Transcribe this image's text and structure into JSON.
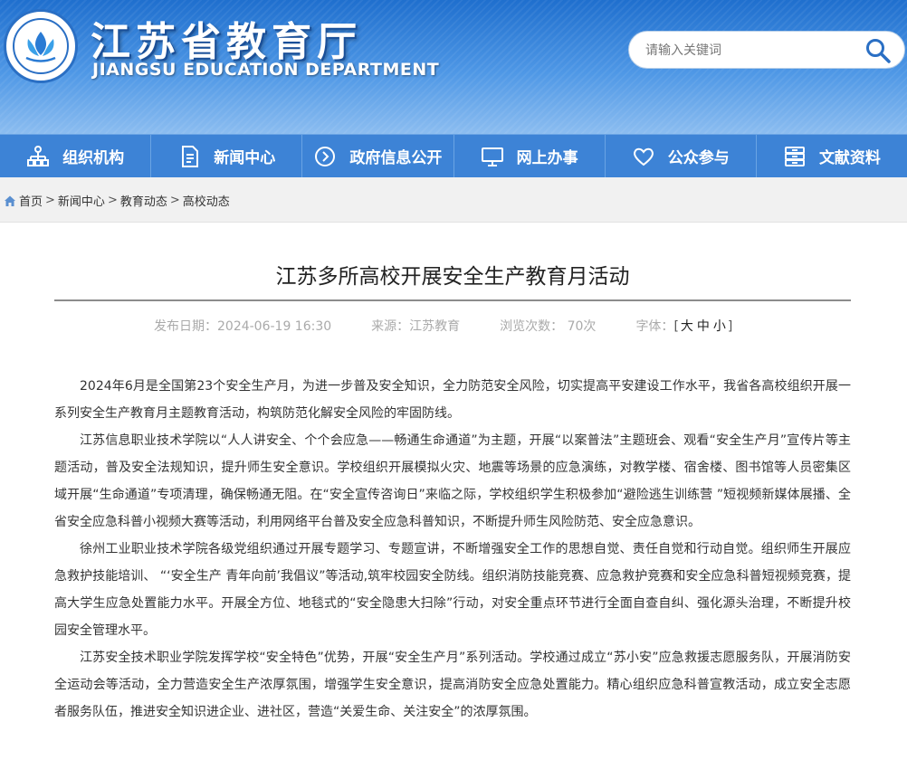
{
  "header": {
    "title_cn": "江苏省教育厅",
    "title_en": "JIANGSU EDUCATION DEPARTMENT",
    "search_placeholder": "请输入关键词"
  },
  "nav": {
    "items": [
      {
        "label": "组织机构",
        "icon": "org-chart-icon"
      },
      {
        "label": "新闻中心",
        "icon": "document-icon"
      },
      {
        "label": "政府信息公开",
        "icon": "disclosure-icon"
      },
      {
        "label": "网上办事",
        "icon": "monitor-icon"
      },
      {
        "label": "公众参与",
        "icon": "heart-icon"
      },
      {
        "label": "文献资料",
        "icon": "archive-icon"
      }
    ]
  },
  "breadcrumb": {
    "items": [
      "首页",
      "新闻中心",
      "教育动态",
      "高校动态"
    ],
    "separator": ">"
  },
  "article": {
    "title": "江苏多所高校开展安全生产教育月活动",
    "meta": {
      "date": "发布日期：2024-06-19 16:30",
      "source": "来源：江苏教育",
      "views": "浏览次数： 70次",
      "font_label": "字体：",
      "font_open": "[",
      "font_large": "大",
      "font_medium": "中",
      "font_small": "小",
      "font_close": "]"
    },
    "paragraphs": [
      "2024年6月是全国第23个安全生产月，为进一步普及安全知识，全力防范安全风险，切实提高平安建设工作水平，我省各高校组织开展一系列安全生产教育月主题教育活动，构筑防范化解安全风险的牢固防线。",
      "江苏信息职业技术学院以“人人讲安全、个个会应急——畅通生命通道”为主题，开展“以案普法”主题班会、观看“安全生产月”宣传片等主题活动，普及安全法规知识，提升师生安全意识。学校组织开展模拟火灾、地震等场景的应急演练，对教学楼、宿舍楼、图书馆等人员密集区域开展“生命通道”专项清理，确保畅通无阻。在“安全宣传咨询日”来临之际，学校组织学生积极参加“避险逃生训练营 ”短视频新媒体展播、全省安全应急科普小视频大赛等活动，利用网络平台普及安全应急科普知识，不断提升师生风险防范、安全应急意识。",
      "徐州工业职业技术学院各级党组织通过开展专题学习、专题宣讲，不断增强安全工作的思想自觉、责任自觉和行动自觉。组织师生开展应急救护技能培训、 “‘安全生产 青年向前’我倡议”等活动,筑牢校园安全防线。组织消防技能竞赛、应急救护竞赛和安全应急科普短视频竞赛，提高大学生应急处置能力水平。开展全方位、地毯式的“安全隐患大扫除”行动，对安全重点环节进行全面自查自纠、强化源头治理，不断提升校园安全管理水平。",
      "江苏安全技术职业学院发挥学校“安全特色”优势，开展“安全生产月”系列活动。学校通过成立“苏小安”应急救援志愿服务队，开展消防安全运动会等活动，全力营造安全生产浓厚氛围，增强学生安全意识，提高消防安全应急处置能力。精心组织应急科普宣教活动，成立安全志愿者服务队伍，推进安全知识进企业、进社区，营造“关爱生命、关注安全”的浓厚氛围。"
    ]
  }
}
